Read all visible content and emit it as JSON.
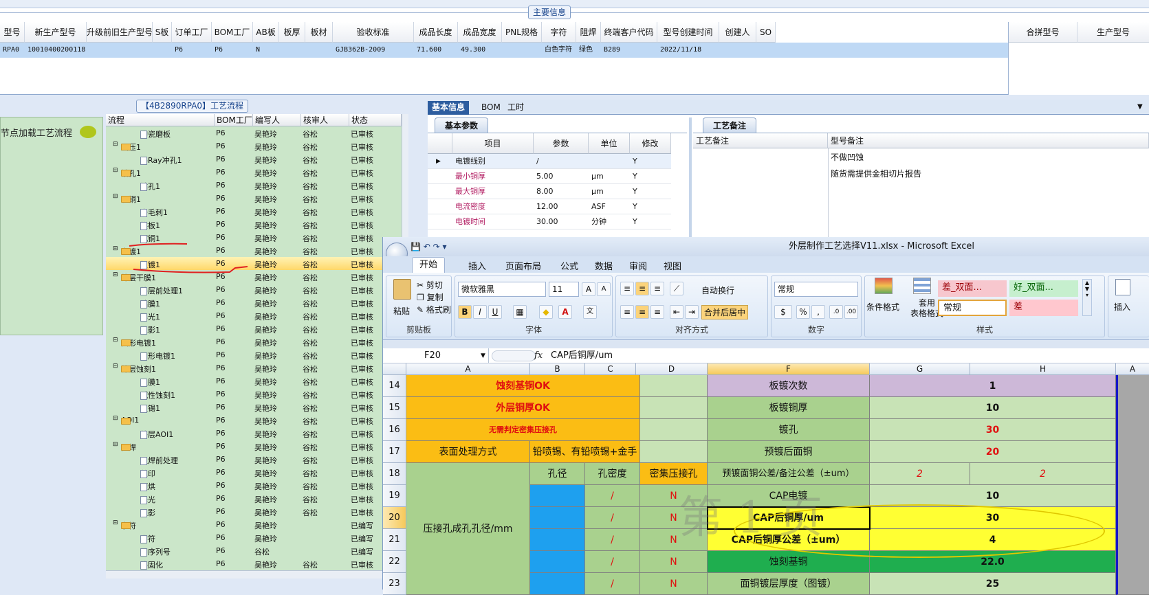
{
  "main_info": {
    "title": "主要信息",
    "columns": [
      "型号",
      "新生产型号",
      "升级前旧生产型号",
      "S板",
      "订单工厂",
      "BOM工厂",
      "AB板",
      "板厚",
      "板材",
      "验收标准",
      "成品长度",
      "成品宽度",
      "PNL规格",
      "字符",
      "阻焊",
      "终端客户代码",
      "型号创建时间",
      "创建人",
      "SO"
    ],
    "row": [
      "RPA0",
      "10010400200118",
      "",
      "",
      "P6",
      "P6",
      "N",
      "",
      "",
      "GJB362B-2009",
      "71.600",
      "49.300",
      "",
      "白色字符",
      "绿色",
      "B289",
      "2022/11/18",
      "",
      ""
    ],
    "right_columns": [
      "合拼型号",
      "生产型号"
    ]
  },
  "flow": {
    "caption": "【4B2890RPA0】工艺流程",
    "left_hint": "节点加载工艺流程",
    "columns": [
      "流程",
      "BOM工厂",
      "编写人",
      "核审人",
      "状态"
    ],
    "rows": [
      {
        "name": "陶瓷磨板",
        "level": 2,
        "bom": "P6",
        "writer": "吴艳玲",
        "reviewer": "谷松",
        "status": "已审核"
      },
      {
        "name": "层压1",
        "level": 1,
        "bom": "P6",
        "writer": "吴艳玲",
        "reviewer": "谷松",
        "status": "已审核"
      },
      {
        "name": "X-Ray冲孔1",
        "level": 2,
        "bom": "P6",
        "writer": "吴艳玲",
        "reviewer": "谷松",
        "status": "已审核"
      },
      {
        "name": "钻孔1",
        "level": 1,
        "bom": "P6",
        "writer": "吴艳玲",
        "reviewer": "谷松",
        "status": "已审核"
      },
      {
        "name": "钻孔1",
        "level": 2,
        "bom": "P6",
        "writer": "吴艳玲",
        "reviewer": "谷松",
        "status": "已审核"
      },
      {
        "name": "沉铜1",
        "level": 1,
        "bom": "P6",
        "writer": "吴艳玲",
        "reviewer": "谷松",
        "status": "已审核"
      },
      {
        "name": "去毛刺1",
        "level": 2,
        "bom": "P6",
        "writer": "吴艳玲",
        "reviewer": "谷松",
        "status": "已审核"
      },
      {
        "name": "烘板1",
        "level": 2,
        "bom": "P6",
        "writer": "吴艳玲",
        "reviewer": "谷松",
        "status": "已审核"
      },
      {
        "name": "沉铜1",
        "level": 2,
        "bom": "P6",
        "writer": "吴艳玲",
        "reviewer": "谷松",
        "status": "已审核"
      },
      {
        "name": "电镀1",
        "level": 1,
        "bom": "P6",
        "writer": "吴艳玲",
        "reviewer": "谷松",
        "status": "已审核"
      },
      {
        "name": "板镀1",
        "level": 2,
        "bom": "P6",
        "writer": "吴艳玲",
        "reviewer": "谷松",
        "status": "已审核"
      },
      {
        "name": "外层干膜1",
        "level": 1,
        "bom": "P6",
        "writer": "吴艳玲",
        "reviewer": "谷松",
        "status": "已审核"
      },
      {
        "name": "外层前处理1",
        "level": 2,
        "bom": "P6",
        "writer": "吴艳玲",
        "reviewer": "谷松",
        "status": "已审核"
      },
      {
        "name": "贴膜1",
        "level": 2,
        "bom": "P6",
        "writer": "吴艳玲",
        "reviewer": "谷松",
        "status": "已审核"
      },
      {
        "name": "曝光1",
        "level": 2,
        "bom": "P6",
        "writer": "吴艳玲",
        "reviewer": "谷松",
        "status": "已审核"
      },
      {
        "name": "显影1",
        "level": 2,
        "bom": "P6",
        "writer": "吴艳玲",
        "reviewer": "谷松",
        "status": "已审核"
      },
      {
        "name": "图形电镀1",
        "level": 1,
        "bom": "P6",
        "writer": "吴艳玲",
        "reviewer": "谷松",
        "status": "已审核"
      },
      {
        "name": "图形电镀1",
        "level": 2,
        "bom": "P6",
        "writer": "吴艳玲",
        "reviewer": "谷松",
        "status": "已审核"
      },
      {
        "name": "外层蚀刻1",
        "level": 1,
        "bom": "P6",
        "writer": "吴艳玲",
        "reviewer": "谷松",
        "status": "已审核"
      },
      {
        "name": "退膜1",
        "level": 2,
        "bom": "P6",
        "writer": "吴艳玲",
        "reviewer": "谷松",
        "status": "已审核"
      },
      {
        "name": "碱性蚀刻1",
        "level": 2,
        "bom": "P6",
        "writer": "吴艳玲",
        "reviewer": "谷松",
        "status": "已审核"
      },
      {
        "name": "退锡1",
        "level": 2,
        "bom": "P6",
        "writer": "吴艳玲",
        "reviewer": "谷松",
        "status": "已审核"
      },
      {
        "name": "AOI1",
        "level": 1,
        "bom": "P6",
        "writer": "吴艳玲",
        "reviewer": "谷松",
        "status": "已审核"
      },
      {
        "name": "外层AOI1",
        "level": 2,
        "bom": "P6",
        "writer": "吴艳玲",
        "reviewer": "谷松",
        "status": "已审核"
      },
      {
        "name": "阻焊",
        "level": 1,
        "bom": "P6",
        "writer": "吴艳玲",
        "reviewer": "谷松",
        "status": "已审核"
      },
      {
        "name": "阻焊前处理",
        "level": 2,
        "bom": "P6",
        "writer": "吴艳玲",
        "reviewer": "谷松",
        "status": "已审核"
      },
      {
        "name": "丝印",
        "level": 2,
        "bom": "P6",
        "writer": "吴艳玲",
        "reviewer": "谷松",
        "status": "已审核"
      },
      {
        "name": "预烘",
        "level": 2,
        "bom": "P6",
        "writer": "吴艳玲",
        "reviewer": "谷松",
        "status": "已审核"
      },
      {
        "name": "曝光",
        "level": 2,
        "bom": "P6",
        "writer": "吴艳玲",
        "reviewer": "谷松",
        "status": "已审核"
      },
      {
        "name": "显影",
        "level": 2,
        "bom": "P6",
        "writer": "吴艳玲",
        "reviewer": "谷松",
        "status": "已审核"
      },
      {
        "name": "字符",
        "level": 1,
        "bom": "P6",
        "writer": "吴艳玲",
        "reviewer": "",
        "status": "已编写"
      },
      {
        "name": "字符",
        "level": 2,
        "bom": "P6",
        "writer": "吴艳玲",
        "reviewer": "",
        "status": "已编写"
      },
      {
        "name": "印序列号",
        "level": 2,
        "bom": "P6",
        "writer": "谷松",
        "reviewer": "",
        "status": "已编写"
      },
      {
        "name": "终固化",
        "level": 2,
        "bom": "P6",
        "writer": "吴艳玲",
        "reviewer": "谷松",
        "status": "已审核"
      }
    ]
  },
  "basic": {
    "tabs": [
      "基本信息",
      "BOM",
      "工时"
    ],
    "params_tab": "基本参数",
    "params_columns": [
      "项目",
      "参数",
      "单位",
      "修改"
    ],
    "params": [
      {
        "item": "电镀线别",
        "value": "/",
        "unit": "",
        "edit": "Y"
      },
      {
        "item": "最小铜厚",
        "value": "5.00",
        "unit": "μm",
        "edit": "Y"
      },
      {
        "item": "最大铜厚",
        "value": "8.00",
        "unit": "μm",
        "edit": "Y"
      },
      {
        "item": "电流密度",
        "value": "12.00",
        "unit": "ASF",
        "edit": "Y"
      },
      {
        "item": "电镀时间",
        "value": "30.00",
        "unit": "分钟",
        "edit": "Y"
      }
    ],
    "notes_tab": "工艺备注",
    "notes_columns": [
      "工艺备注",
      "型号备注"
    ],
    "model_notes": [
      "不做凹蚀",
      "随货需提供金相切片报告"
    ]
  },
  "excel": {
    "title": "外层制作工艺选择V11.xlsx - Microsoft Excel",
    "menus": [
      "开始",
      "插入",
      "页面布局",
      "公式",
      "数据",
      "审阅",
      "视图"
    ],
    "clipboard": {
      "paste": "粘贴",
      "cut": "剪切",
      "copy": "复制",
      "format_painter": "格式刷",
      "label": "剪贴板"
    },
    "font": {
      "name": "微软雅黑",
      "size": "11",
      "label": "字体"
    },
    "align": {
      "wrap": "自动换行",
      "merge": "合并后居中",
      "label": "对齐方式"
    },
    "number": {
      "format": "常规",
      "label": "数字"
    },
    "styles": {
      "cond": "条件格式",
      "table": "套用\n表格格式",
      "s1": "差_双面...",
      "s2": "好_双面...",
      "s3": "常规",
      "s4": "差",
      "label": "样式"
    },
    "insert_label": "插入",
    "name_box": "F20",
    "formula": "CAP后铜厚/um",
    "col_headers": [
      "A",
      "B",
      "C",
      "D",
      "F",
      "G",
      "H",
      "A"
    ],
    "row_numbers": [
      "14",
      "15",
      "16",
      "17",
      "18",
      "19",
      "20",
      "21",
      "22",
      "23"
    ],
    "cells": {
      "a14": "蚀刻基铜OK",
      "a15": "外层铜厚OK",
      "a16": "无需判定密集压接孔",
      "a17": "表面处理方式",
      "bc17": "铅喷锡、有铅喷锡+金手",
      "a_merge": "压接孔成孔孔径/mm",
      "b18": "孔径",
      "c18": "孔密度",
      "d18": "密集压接孔",
      "slash": "/",
      "n": "N",
      "f14": "板镀次数",
      "g14": "1",
      "f15": "板镀铜厚",
      "g15": "10",
      "f16": "镀孔",
      "g16": "30",
      "f17": "预镀后面铜",
      "g17": "20",
      "f18": "预镀面铜公差/备注公差（±um）",
      "g18": "2",
      "h18": "2",
      "f19": "CAP电镀",
      "g19": "10",
      "f20": "CAP后铜厚/um",
      "g20": "30",
      "f21": "CAP后铜厚公差（±um）",
      "g21": "4",
      "f22": "蚀刻基铜",
      "g22": "22.0",
      "f23": "面铜镀层厚度（图镀）",
      "g23": "25"
    },
    "watermark": "第 1 页"
  },
  "colors": {
    "selection": "#bfd9f5",
    "tree_bg": "#cbe6c9",
    "excel_orange": "#fbbd14",
    "excel_green": "#a9d18e",
    "excel_yellow": "#ffff33",
    "excel_lav": "#cdb8d8"
  }
}
